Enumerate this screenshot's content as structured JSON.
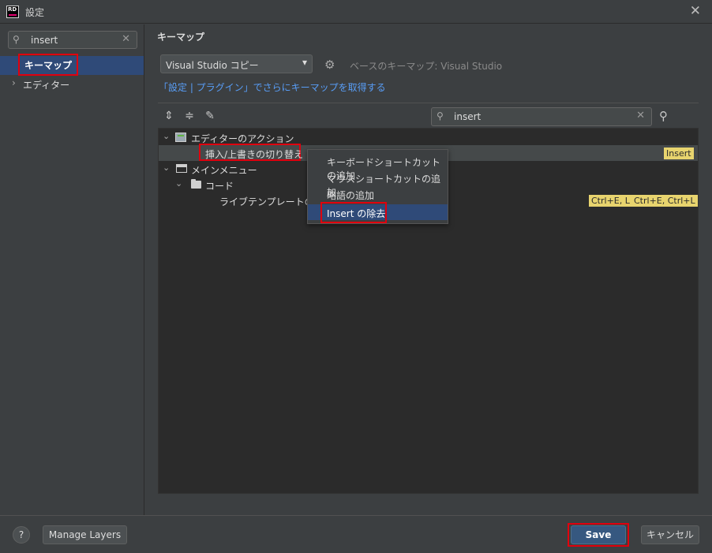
{
  "window": {
    "logo": "RD",
    "title": "設定",
    "close_glyph": "✕"
  },
  "sidebar": {
    "search_value": "insert",
    "items": [
      {
        "label": "キーマップ",
        "selected": true
      },
      {
        "label": "エディター",
        "selected": false
      }
    ]
  },
  "main": {
    "title": "キーマップ",
    "keymap_select": "Visual Studio コピー",
    "base_keymap": "ベースのキーマップ: Visual Studio",
    "plugin_link": "「設定 | プラグイン」でさらにキーマップを取得する",
    "search_value": "insert",
    "tree": {
      "editor_actions": "エディターのアクション",
      "toggle_insert": {
        "label": "挿入/上書きの切り替え",
        "shortcut": "Insert"
      },
      "main_menu": "メインメニュー",
      "code": "コード",
      "live_template": {
        "label": "ライブテンプレートの挿入",
        "shortcuts": [
          "Ctrl+E, L",
          "Ctrl+E, Ctrl+L"
        ]
      }
    },
    "context_menu": [
      "キーボードショートカットの追加",
      "マウスショートカットの追加",
      "略語の追加",
      "Insert の除去"
    ]
  },
  "footer": {
    "help": "?",
    "manage_layers": "Manage Layers",
    "save": "Save",
    "cancel": "キャンセル"
  },
  "colors": {
    "background": "#3c3f41",
    "panel": "#2b2b2b",
    "selection": "#2f4a78",
    "highlight_border": "#e0000e",
    "shortcut_badge": "#e8d46e",
    "link": "#589df6"
  }
}
